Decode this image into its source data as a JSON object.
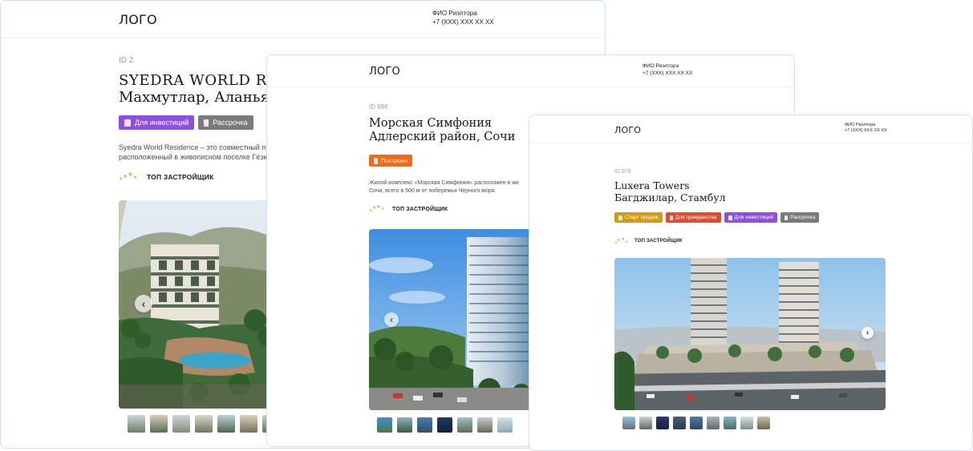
{
  "cards": [
    {
      "logo": "ЛОГО",
      "agent_name": "ФИО Риэлтора",
      "agent_phone": "+7 (XXX) XXX XX XX",
      "id_label": "ID 2",
      "title_line1": "SYEDRA WORLD RESIDENCE",
      "title_line2": "Махмутлар, Аланья",
      "badges": [
        {
          "label": "Для инвестиций",
          "color": "#8c4fe0",
          "icon": "coins-icon"
        },
        {
          "label": "Рассрочка",
          "color": "#7b7b7b",
          "icon": "hourglass-icon"
        }
      ],
      "description": [
        "Syedra World Residence – это совместный проект",
        "расположенный в живописном поселке Гёзюкёй"
      ],
      "top_label": "ТОП ЗАСТРОЙЩИК",
      "arrow_left": "‹"
    },
    {
      "logo": "ЛОГО",
      "agent_name": "ФИО Риэлтора",
      "agent_phone": "+7 (XXX) XXX XX XX",
      "id_label": "ID 996",
      "title_line1": "Морская Симфония",
      "title_line2": "Адлерский район, Сочи",
      "badges": [
        {
          "label": "Построен",
          "color": "#f26a16",
          "icon": "building-icon"
        }
      ],
      "description": [
        "Жилой комплекс «Морская Симфония» расположен в жи",
        "Сочи, всего в 500 м от побережья Черного моря."
      ],
      "top_label": "ТОП ЗАСТРОЙЩИК",
      "arrow_left": "‹"
    },
    {
      "logo": "ЛОГО",
      "agent_name": "ФИО Риэлтора",
      "agent_phone": "+7 (XXX) XXX XX XX",
      "id_label": "ID 976",
      "title_line1": "Luxera Towers",
      "title_line2": "Багджилар, Стамбул",
      "badges": [
        {
          "label": "Старт продаж",
          "color": "#d19b15",
          "icon": "rocket-icon"
        },
        {
          "label": "Для гражданства",
          "color": "#e04a2f",
          "icon": "passport-icon"
        },
        {
          "label": "Для инвестиций",
          "color": "#8c4fe0",
          "icon": "coins-icon"
        },
        {
          "label": "Рассрочка",
          "color": "#7b7b7b",
          "icon": "hourglass-icon"
        }
      ],
      "top_label": "ТОП ЗАСТРОЙЩИК",
      "arrow_right": "›"
    }
  ]
}
